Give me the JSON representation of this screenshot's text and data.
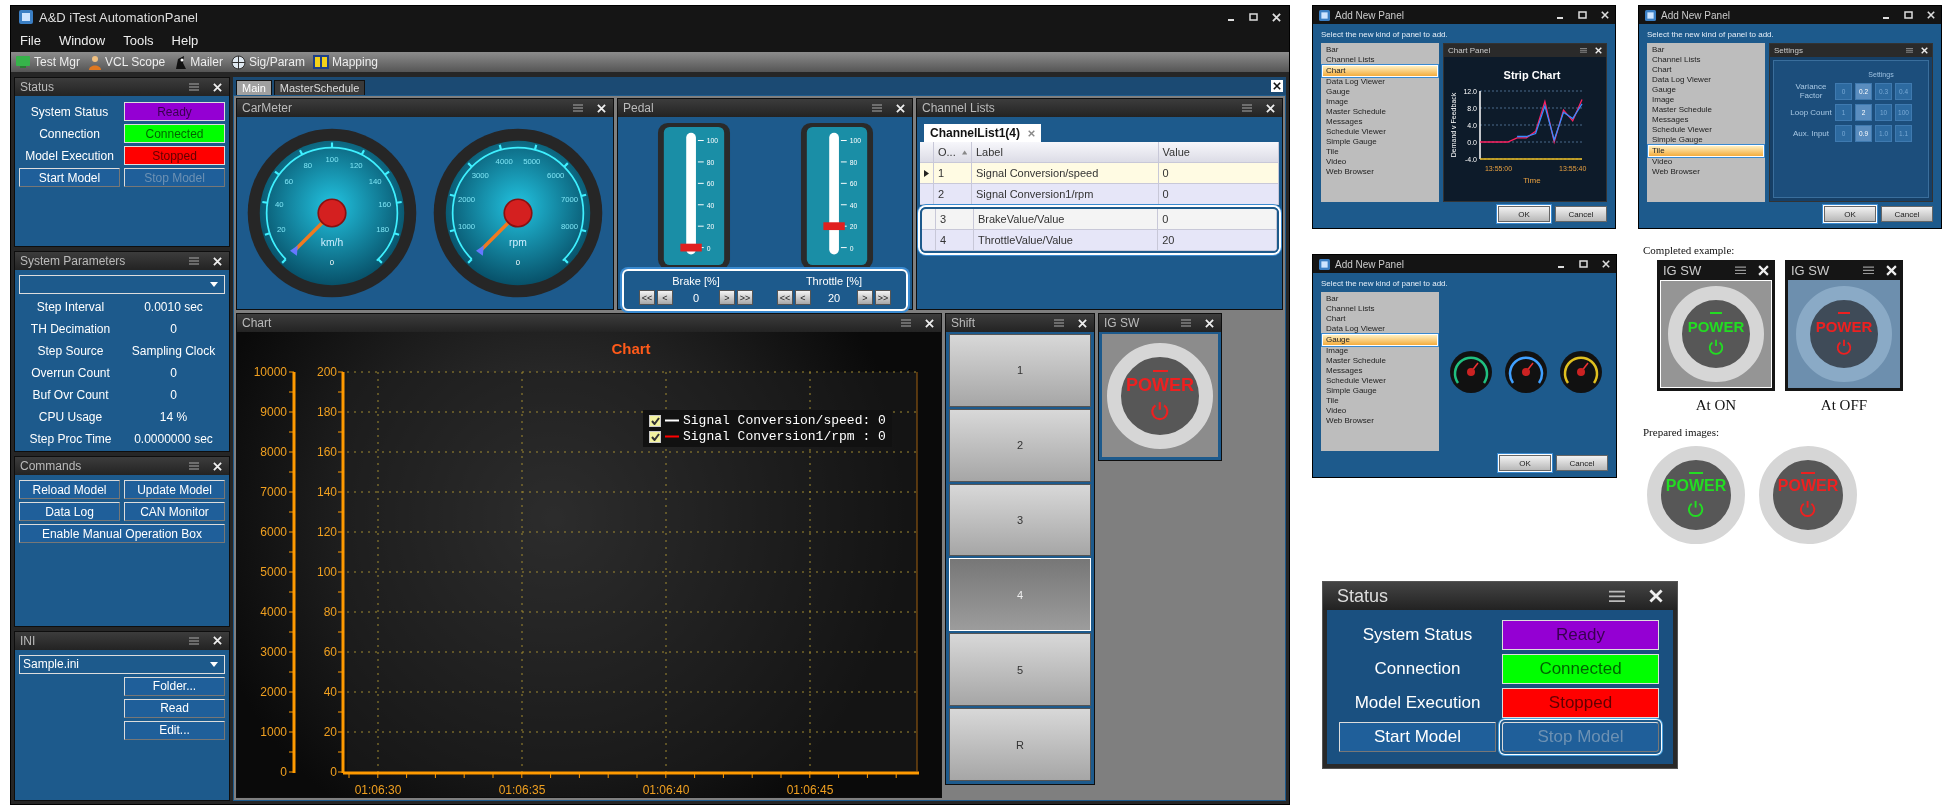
{
  "window": {
    "title": "A&D iTest AutomationPanel",
    "menu": [
      "File",
      "Window",
      "Tools",
      "Help"
    ],
    "toolbar": [
      {
        "label": "Test Mgr",
        "kind": "manager"
      },
      {
        "label": "VCL Scope",
        "kind": "scope"
      },
      {
        "label": "Mailer",
        "kind": "mailer"
      },
      {
        "label": "Sig/Param",
        "kind": "signal"
      },
      {
        "label": "Mapping",
        "kind": "mapping"
      }
    ]
  },
  "status": {
    "title": "Status",
    "rows": [
      {
        "label": "System Status",
        "value": "Ready",
        "color": "#9400d3"
      },
      {
        "label": "Connection",
        "value": "Connected",
        "color": "#00ff00"
      },
      {
        "label": "Model Execution",
        "value": "Stopped",
        "color": "#ff0000"
      }
    ],
    "buttons": [
      {
        "label": "Start Model",
        "disabled": false,
        "highlighted": false
      },
      {
        "label": "Stop Model",
        "disabled": true,
        "highlighted": false
      }
    ]
  },
  "system_parameters": {
    "title": "System Parameters",
    "rows": [
      {
        "label": "Step Interval",
        "value": "0.0010 sec"
      },
      {
        "label": "TH Decimation",
        "value": "0"
      },
      {
        "label": "Step Source",
        "value": "Sampling Clock"
      },
      {
        "label": "Overrun Count",
        "value": "0"
      },
      {
        "label": "Buf Ovr Count",
        "value": "0"
      },
      {
        "label": "CPU Usage",
        "value": "14 %"
      },
      {
        "label": "Step Proc Time",
        "value": "0.0000000 sec"
      }
    ]
  },
  "commands": {
    "title": "Commands",
    "buttons": [
      "Reload Model",
      "Update Model",
      "Data Log",
      "CAN Monitor",
      "Enable Manual Operation Box"
    ]
  },
  "ini": {
    "title": "INI",
    "file": "Sample.ini",
    "buttons": [
      "Folder...",
      "Read",
      "Edit..."
    ]
  },
  "tabs": [
    {
      "label": "Main",
      "selected": true
    },
    {
      "label": "MasterSchedule",
      "selected": false
    }
  ],
  "car_meter": {
    "title": "CarMeter",
    "gauges": [
      {
        "unit": "km/h",
        "reading": "0",
        "scale": [
          "20",
          "40",
          "60",
          "80",
          "100",
          "120",
          "140",
          "160",
          "180"
        ]
      },
      {
        "unit": "rpm",
        "reading": "0",
        "scale": [
          "1000",
          "2000",
          "3000",
          "4000",
          "5000",
          "6000",
          "7000",
          "8000"
        ]
      }
    ]
  },
  "pedal": {
    "title": "Pedal",
    "highlighted": true,
    "pedals": [
      {
        "scale": [
          "100",
          "80",
          "60",
          "40",
          "20",
          "0"
        ],
        "label": "Brake [%]",
        "value": "0",
        "level": 0,
        "buttons_before": [
          "<<",
          "<"
        ],
        "buttons_after": [
          ">",
          ">>"
        ]
      },
      {
        "scale": [
          "100",
          "80",
          "60",
          "40",
          "20",
          "0"
        ],
        "label": "Throttle [%]",
        "value": "20",
        "level": 0.2,
        "buttons_before": [
          "<<",
          "<"
        ],
        "buttons_after": [
          ">",
          ">>"
        ]
      }
    ]
  },
  "channel_lists": {
    "title": "Channel Lists",
    "tab": "ChannelList1(4)",
    "columns": [
      "O...",
      "Label",
      "Value"
    ],
    "rows": [
      {
        "cells": [
          "1",
          "Signal Conversion/speed",
          "0"
        ],
        "selected": true,
        "highlighted": false
      },
      {
        "cells": [
          "2",
          "Signal Conversion1/rpm",
          "0"
        ],
        "selected": false,
        "highlighted": false
      },
      {
        "cells": [
          "3",
          "BrakeValue/Value",
          "0"
        ],
        "selected": false,
        "highlighted": true
      },
      {
        "cells": [
          "4",
          "ThrottleValue/Value",
          "20"
        ],
        "selected": false,
        "highlighted": true
      }
    ]
  },
  "chart": {
    "title": "Chart",
    "chart_data": {
      "type": "line",
      "title": "Chart",
      "grid": true,
      "x": [
        "01:06:30",
        "01:06:35",
        "01:06:40",
        "01:06:45"
      ],
      "ylim": [
        0,
        200
      ],
      "yticks": [
        0,
        20,
        40,
        60,
        80,
        100,
        120,
        140,
        160,
        180,
        200
      ]
    },
    "secondary_yticks": [
      "10000",
      "9000",
      "8000",
      "7000",
      "6000",
      "5000",
      "4000",
      "3000",
      "2000",
      "1000",
      "0"
    ],
    "legend": [
      {
        "label": "Signal Conversion/speed: 0",
        "color": "#ffffff",
        "checked": true
      },
      {
        "label": "Signal Conversion1/rpm : 0",
        "color": "#ff0000",
        "checked": true
      }
    ]
  },
  "shift": {
    "title": "Shift",
    "gears": [
      {
        "label": "1",
        "selected": false
      },
      {
        "label": "2",
        "selected": false
      },
      {
        "label": "3",
        "selected": false
      },
      {
        "label": "4",
        "selected": true
      },
      {
        "label": "5",
        "selected": false
      },
      {
        "label": "R",
        "selected": false
      }
    ]
  },
  "ig_switch": {
    "title": "IG SW",
    "label": "POWER",
    "on": false
  },
  "dialogs": [
    {
      "title": "Add New Panel",
      "prompt": "Select the new kind of panel to add.",
      "items": [
        {
          "label": "Bar",
          "selected": false
        },
        {
          "label": "Channel Lists",
          "selected": false
        },
        {
          "label": "Chart",
          "selected": true
        },
        {
          "label": "Data Log Viewer",
          "selected": false
        },
        {
          "label": "Gauge",
          "selected": false
        },
        {
          "label": "Image",
          "selected": false
        },
        {
          "label": "Master Schedule",
          "selected": false
        },
        {
          "label": "Messages",
          "selected": false
        },
        {
          "label": "Schedule Viewer",
          "selected": false
        },
        {
          "label": "Simple Gauge",
          "selected": false
        },
        {
          "label": "Tile",
          "selected": false
        },
        {
          "label": "Video",
          "selected": false
        },
        {
          "label": "Web Browser",
          "selected": false
        }
      ],
      "preview": {
        "kind": "chart",
        "title": "Chart Panel",
        "chart_data": {
          "type": "line",
          "title": "Strip Chart",
          "xlabel": "Time",
          "ylabel": "Demand v Feedback",
          "grid": true,
          "categories": [
            null,
            null,
            "13:55:00",
            null,
            null,
            null,
            null,
            null,
            null,
            null,
            "13:55:40",
            null
          ],
          "ylim": [
            -4,
            12
          ],
          "yticks": [
            {
              "value": -4,
              "label": "-4.0"
            },
            {
              "value": 0,
              "label": "0.0"
            },
            {
              "value": 4,
              "label": "4.0"
            },
            {
              "value": 8,
              "label": "8.0"
            },
            {
              "value": 12,
              "label": "12.0"
            }
          ],
          "series": [
            {
              "color": "#ff2060",
              "values": [
                0,
                0,
                0,
                0,
                1,
                1,
                2.5,
                9.5,
                0,
                7.5,
                5,
                10
              ]
            },
            {
              "color": "#3a8cff",
              "values": [
                null,
                null,
                null,
                null,
                1.3,
                1.3,
                2,
                8.5,
                0.5,
                7,
                5.5,
                9
              ]
            }
          ]
        }
      },
      "buttons": [
        {
          "label": "OK",
          "highlighted": true
        },
        {
          "label": "Cancel",
          "highlighted": false
        }
      ]
    },
    {
      "title": "Add New Panel",
      "prompt": "Select the new kind of panel to add.",
      "items": [
        {
          "label": "Bar",
          "selected": false
        },
        {
          "label": "Channel Lists",
          "selected": false
        },
        {
          "label": "Chart",
          "selected": false
        },
        {
          "label": "Data Log Viewer",
          "selected": false
        },
        {
          "label": "Gauge",
          "selected": false
        },
        {
          "label": "Image",
          "selected": false
        },
        {
          "label": "Master Schedule",
          "selected": false
        },
        {
          "label": "Messages",
          "selected": false
        },
        {
          "label": "Schedule Viewer",
          "selected": false
        },
        {
          "label": "Simple Gauge",
          "selected": false
        },
        {
          "label": "Tile",
          "selected": true
        },
        {
          "label": "Video",
          "selected": false
        },
        {
          "label": "Web Browser",
          "selected": false
        }
      ],
      "preview": {
        "kind": "settings",
        "title": "Settings",
        "heading": "Settings",
        "rows": [
          {
            "label": "Variance Factor",
            "options": [
              {
                "label": "0",
                "selected": false
              },
              {
                "label": "0.2",
                "selected": true
              },
              {
                "label": "0.3",
                "selected": false
              },
              {
                "label": "0.4",
                "selected": false
              }
            ]
          },
          {
            "label": "Loop Count",
            "options": [
              {
                "label": "1",
                "selected": false
              },
              {
                "label": "2",
                "selected": true
              },
              {
                "label": "10",
                "selected": false
              },
              {
                "label": "100",
                "selected": false
              }
            ]
          },
          {
            "label": "Aux. Input",
            "options": [
              {
                "label": "0",
                "selected": false
              },
              {
                "label": "0.9",
                "selected": true
              },
              {
                "label": "1.0",
                "selected": false
              },
              {
                "label": "1.1",
                "selected": false
              }
            ]
          }
        ]
      },
      "buttons": [
        {
          "label": "OK",
          "highlighted": true
        },
        {
          "label": "Cancel",
          "highlighted": false
        }
      ]
    },
    {
      "title": "Add New Panel",
      "prompt": "Select the new kind of panel to add.",
      "items": [
        {
          "label": "Bar",
          "selected": false
        },
        {
          "label": "Channel Lists",
          "selected": false
        },
        {
          "label": "Chart",
          "selected": false
        },
        {
          "label": "Data Log Viewer",
          "selected": false
        },
        {
          "label": "Gauge",
          "selected": true
        },
        {
          "label": "Image",
          "selected": false
        },
        {
          "label": "Master Schedule",
          "selected": false
        },
        {
          "label": "Messages",
          "selected": false
        },
        {
          "label": "Schedule Viewer",
          "selected": false
        },
        {
          "label": "Simple Gauge",
          "selected": false
        },
        {
          "label": "Tile",
          "selected": false
        },
        {
          "label": "Video",
          "selected": false
        },
        {
          "label": "Web Browser",
          "selected": false
        }
      ],
      "preview": {
        "kind": "gauges"
      },
      "buttons": [
        {
          "label": "OK",
          "highlighted": true
        },
        {
          "label": "Cancel",
          "highlighted": false
        }
      ]
    }
  ],
  "examples": {
    "completed_caption": "Completed example:",
    "panels": [
      {
        "title": "IG SW",
        "label": "POWER",
        "on": true,
        "disabled": false,
        "caption": "At ON"
      },
      {
        "title": "IG SW",
        "label": "POWER",
        "on": false,
        "disabled": true,
        "caption": "At OFF"
      }
    ],
    "prepared_caption": "Prepared images:",
    "images": [
      {
        "label": "POWER",
        "on": true
      },
      {
        "label": "POWER",
        "on": false
      }
    ]
  },
  "status_closeup": {
    "title": "Status",
    "rows": [
      {
        "label": "System Status",
        "value": "Ready",
        "color": "#9400d3"
      },
      {
        "label": "Connection",
        "value": "Connected",
        "color": "#00ff00"
      },
      {
        "label": "Model Execution",
        "value": "Stopped",
        "color": "#ff0000"
      }
    ],
    "buttons": [
      {
        "label": "Start Model",
        "disabled": false,
        "highlighted": false
      },
      {
        "label": "Stop Model",
        "disabled": true,
        "highlighted": true
      }
    ]
  }
}
